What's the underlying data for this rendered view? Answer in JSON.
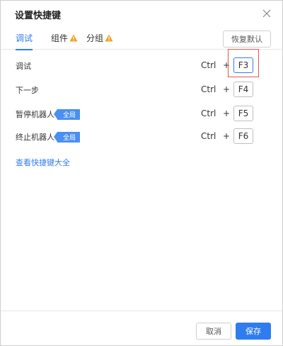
{
  "dialog": {
    "title": "设置快捷键",
    "close_icon": "close-icon"
  },
  "tabs": [
    {
      "label": "调试",
      "active": true,
      "warning": false
    },
    {
      "label": "组件",
      "active": false,
      "warning": true
    },
    {
      "label": "分组",
      "active": false,
      "warning": true
    }
  ],
  "restore_label": "恢复默认",
  "shortcuts": [
    {
      "label": "调试",
      "badge": "",
      "modifier": "Ctrl",
      "plus": "+",
      "key": "F3"
    },
    {
      "label": "下一步",
      "badge": "",
      "modifier": "Ctrl",
      "plus": "+",
      "key": "F4"
    },
    {
      "label": "暂停机器人",
      "badge": "全局",
      "modifier": "Ctrl",
      "plus": "+",
      "key": "F5"
    },
    {
      "label": "终止机器人",
      "badge": "全局",
      "modifier": "Ctrl",
      "plus": "+",
      "key": "F6"
    }
  ],
  "view_all_link": "查看快捷键大全",
  "footer": {
    "cancel_label": "取消",
    "save_label": "保存"
  },
  "colors": {
    "accent": "#2f7cf0",
    "warning": "#f0a020",
    "highlight": "#e2574c"
  }
}
